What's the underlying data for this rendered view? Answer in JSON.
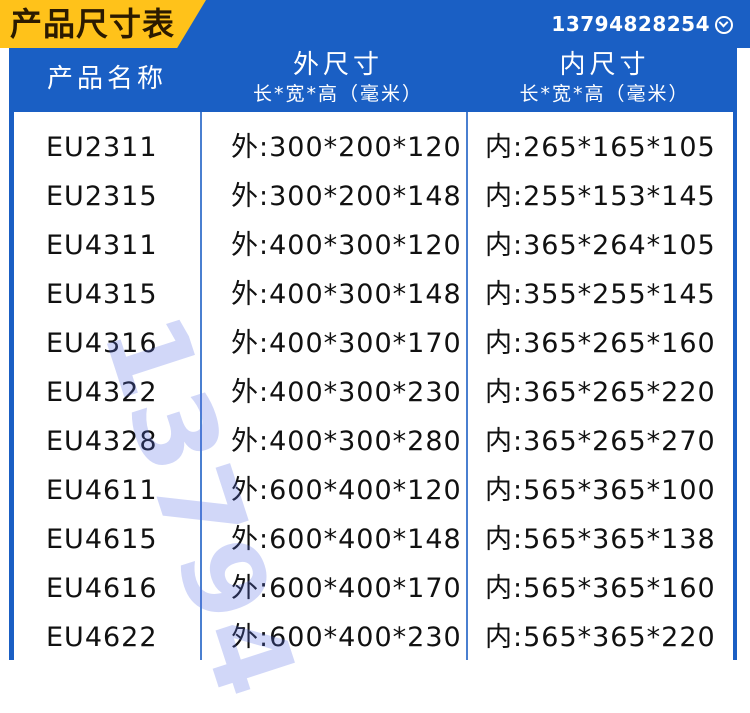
{
  "title": "产品尺寸表",
  "phone": "13794828254",
  "header": {
    "col1": "产品名称",
    "col2_main": "外尺寸",
    "col2_sub": "长*宽*高（毫米）",
    "col3_main": "内尺寸",
    "col3_sub": "长*宽*高（毫米）"
  },
  "rows": [
    {
      "name": "EU2311",
      "outer": "外:300*200*120",
      "inner": "内:265*165*105"
    },
    {
      "name": "EU2315",
      "outer": "外:300*200*148",
      "inner": "内:255*153*145"
    },
    {
      "name": "EU4311",
      "outer": "外:400*300*120",
      "inner": "内:365*264*105"
    },
    {
      "name": "EU4315",
      "outer": "外:400*300*148",
      "inner": "内:355*255*145"
    },
    {
      "name": "EU4316",
      "outer": "外:400*300*170",
      "inner": "内:365*265*160"
    },
    {
      "name": "EU4322",
      "outer": "外:400*300*230",
      "inner": "内:365*265*220"
    },
    {
      "name": "EU4328",
      "outer": "外:400*300*280",
      "inner": "内:365*265*270"
    },
    {
      "name": "EU4611",
      "outer": "外:600*400*120",
      "inner": "内:565*365*100"
    },
    {
      "name": "EU4615",
      "outer": "外:600*400*148",
      "inner": "内:565*365*138"
    },
    {
      "name": "EU4616",
      "outer": "外:600*400*170",
      "inner": "内:565*365*160"
    },
    {
      "name": "EU4622",
      "outer": "外:600*400*230",
      "inner": "内:565*365*220"
    }
  ],
  "watermark": "13794",
  "colors": {
    "brand_blue": "#1a5fc4",
    "tab_yellow": "#ffc21a"
  },
  "icons": {
    "phone_chevron": "chevron-down-circle-icon"
  }
}
